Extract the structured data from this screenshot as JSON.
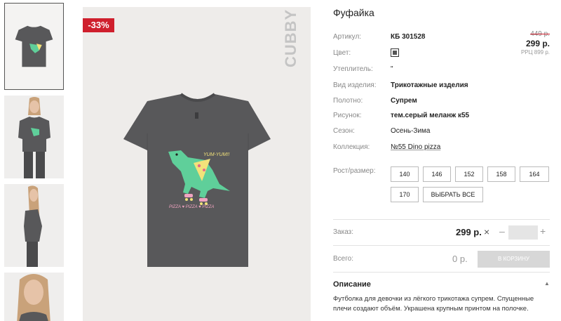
{
  "product": {
    "title": "Фуфайка",
    "discount_badge": "-33%",
    "brand": "CUBBY"
  },
  "attributes": [
    {
      "label": "Артикул:",
      "value": "КБ 301528"
    },
    {
      "label": "Цвет:",
      "value": ""
    },
    {
      "label": "Утеплитель:",
      "value": "\""
    },
    {
      "label": "Вид изделия:",
      "value": "Трикотажные изделия"
    },
    {
      "label": "Полотно:",
      "value": "Супрем"
    },
    {
      "label": "Рисунок:",
      "value": "тем.серый меланж к55"
    },
    {
      "label": "Сезон:",
      "value": "Осень-Зима"
    },
    {
      "label": "Коллекция:",
      "value": "№55 Dino pizza"
    }
  ],
  "pricing": {
    "old_price": "449 р.",
    "price": "299 р.",
    "rrp": "РРЦ 899 р."
  },
  "sizes": {
    "label": "Рост/размер:",
    "options": [
      "140",
      "146",
      "152",
      "158",
      "164",
      "170"
    ],
    "select_all": "ВЫБРАТЬ ВСЕ"
  },
  "order": {
    "label": "Заказ:",
    "price": "299 р.",
    "times": "×",
    "minus": "–",
    "plus": "+",
    "quantity": ""
  },
  "total": {
    "label": "Всего:",
    "value": "0 р.",
    "cart_button": "В КОРЗИНУ"
  },
  "description": {
    "title": "Описание",
    "text": "Футболка для девочки из лёгкого трикотажа супрем. Спущенные плечи создают объём. Украшена крупным принтом на полочке."
  },
  "print": {
    "text_top": "YUM-YUM!!",
    "text_bottom": "PIZZA ♥ PIZZA ♥ PIZZA"
  },
  "colors": {
    "discount": "#cf1f2d",
    "shirt": "#58585a",
    "dino": "#5fcf9a",
    "pizza": "#f2e27a"
  }
}
